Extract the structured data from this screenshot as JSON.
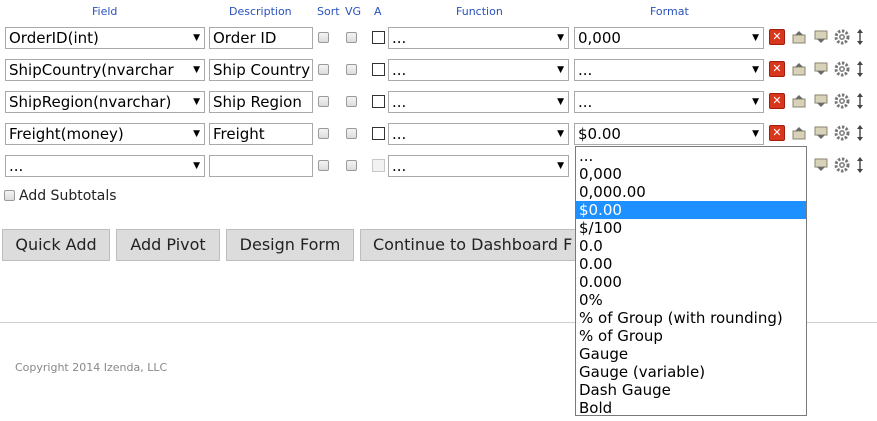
{
  "headers": {
    "field": "Field",
    "description": "Description",
    "sort": "Sort",
    "vg": "VG",
    "a": "A",
    "function": "Function",
    "format": "Format"
  },
  "rows": [
    {
      "field": "OrderID(int)",
      "description": "Order ID",
      "function": "...",
      "format": "0,000"
    },
    {
      "field": "ShipCountry(nvarchar",
      "description": "Ship Country",
      "function": "...",
      "format": "..."
    },
    {
      "field": "ShipRegion(nvarchar)",
      "description": "Ship Region",
      "function": "...",
      "format": "..."
    },
    {
      "field": "Freight(money)",
      "description": "Freight",
      "function": "...",
      "format": "$0.00"
    },
    {
      "field": "...",
      "description": "",
      "function": "...",
      "format": ""
    }
  ],
  "add_subtotals_label": "Add Subtotals",
  "buttons": {
    "quick_add": "Quick Add",
    "add_pivot": "Add Pivot",
    "design_form": "Design Form",
    "continue": "Continue to Dashboard F"
  },
  "format_options": [
    "...",
    "0,000",
    "0,000.00",
    "$0.00",
    "$/100",
    "0.0",
    "0.00",
    "0.000",
    "0%",
    "% of Group (with rounding)",
    "% of Group",
    "Gauge",
    "Gauge (variable)",
    "Dash Gauge",
    "Bold"
  ],
  "selected_format": "$0.00",
  "copyright": "Copyright 2014 Izenda, LLC",
  "colors": {
    "header": "#2a52be",
    "selection": "#1e90ff",
    "delete": "#d9361e"
  }
}
